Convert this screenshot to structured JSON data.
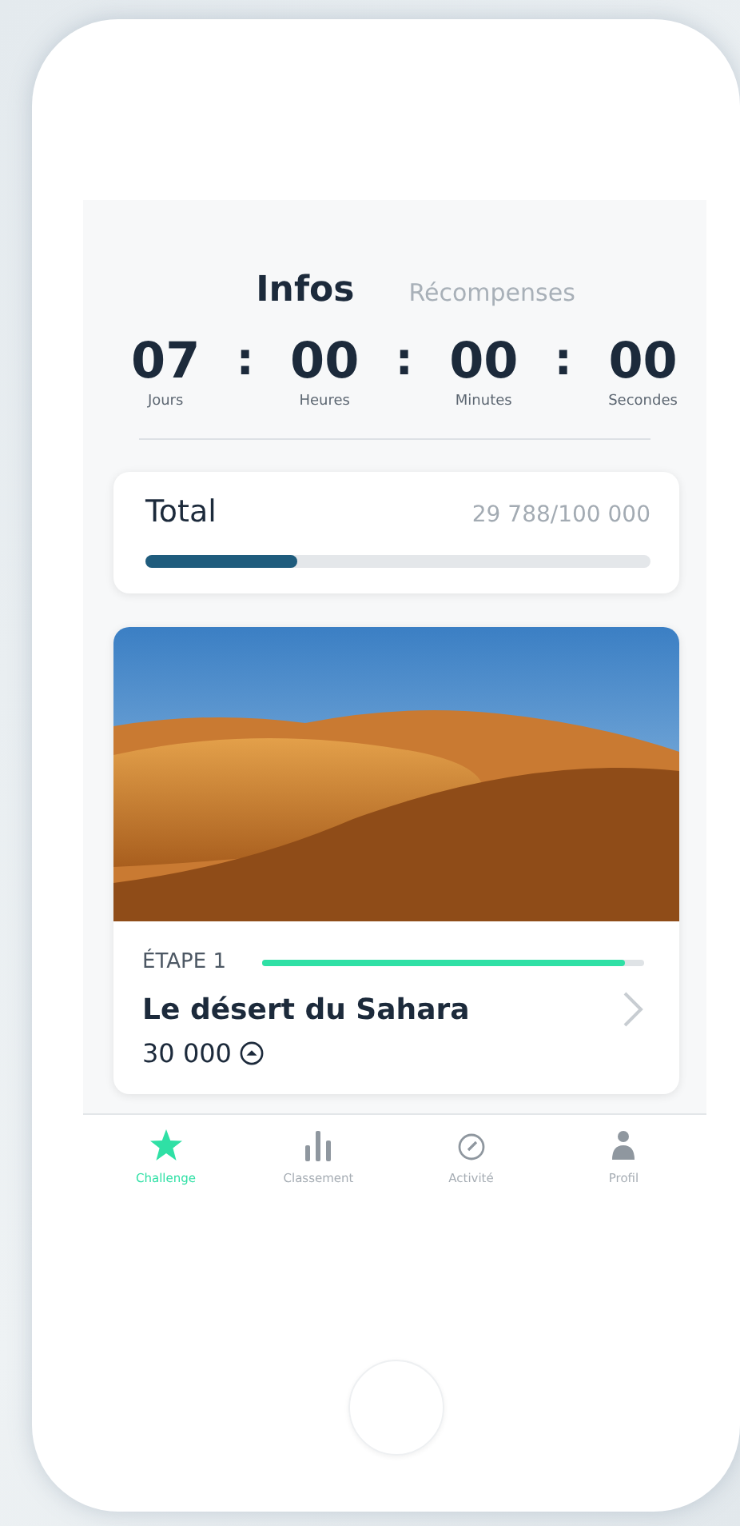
{
  "tabs": [
    {
      "label": "Infos",
      "selected": true
    },
    {
      "label": "Récompenses",
      "selected": false
    }
  ],
  "countdown": [
    {
      "value": "07",
      "unit": "Jours"
    },
    {
      "value": "00",
      "unit": "Heures"
    },
    {
      "value": "00",
      "unit": "Minutes"
    },
    {
      "value": "00",
      "unit": "Secondes"
    }
  ],
  "countdown_separator": ":",
  "total": {
    "label": "Total",
    "reading": "29 788/100 000",
    "level": 0.3
  },
  "stage": {
    "step": "ÉTAPE 1",
    "level": 0.95,
    "title": "Le désert du Sahara",
    "points": "30 000"
  },
  "nav": [
    {
      "label": "Challenge",
      "selected": true
    },
    {
      "label": "Classement",
      "selected": false
    },
    {
      "label": "Activité",
      "selected": false
    },
    {
      "label": "Profil",
      "selected": false
    }
  ]
}
